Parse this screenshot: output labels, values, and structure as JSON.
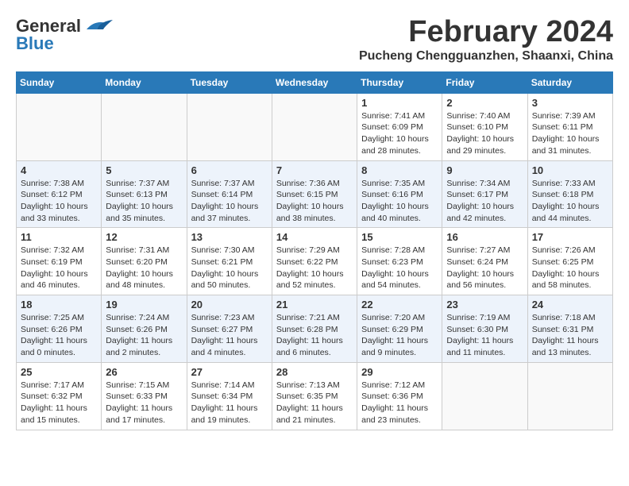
{
  "header": {
    "logo_line1": "General",
    "logo_line2": "Blue",
    "title": "February 2024",
    "subtitle": "Pucheng Chengguanzhen, Shaanxi, China"
  },
  "calendar": {
    "days_of_week": [
      "Sunday",
      "Monday",
      "Tuesday",
      "Wednesday",
      "Thursday",
      "Friday",
      "Saturday"
    ],
    "weeks": [
      [
        {
          "day": "",
          "info": ""
        },
        {
          "day": "",
          "info": ""
        },
        {
          "day": "",
          "info": ""
        },
        {
          "day": "",
          "info": ""
        },
        {
          "day": "1",
          "info": "Sunrise: 7:41 AM\nSunset: 6:09 PM\nDaylight: 10 hours\nand 28 minutes."
        },
        {
          "day": "2",
          "info": "Sunrise: 7:40 AM\nSunset: 6:10 PM\nDaylight: 10 hours\nand 29 minutes."
        },
        {
          "day": "3",
          "info": "Sunrise: 7:39 AM\nSunset: 6:11 PM\nDaylight: 10 hours\nand 31 minutes."
        }
      ],
      [
        {
          "day": "4",
          "info": "Sunrise: 7:38 AM\nSunset: 6:12 PM\nDaylight: 10 hours\nand 33 minutes."
        },
        {
          "day": "5",
          "info": "Sunrise: 7:37 AM\nSunset: 6:13 PM\nDaylight: 10 hours\nand 35 minutes."
        },
        {
          "day": "6",
          "info": "Sunrise: 7:37 AM\nSunset: 6:14 PM\nDaylight: 10 hours\nand 37 minutes."
        },
        {
          "day": "7",
          "info": "Sunrise: 7:36 AM\nSunset: 6:15 PM\nDaylight: 10 hours\nand 38 minutes."
        },
        {
          "day": "8",
          "info": "Sunrise: 7:35 AM\nSunset: 6:16 PM\nDaylight: 10 hours\nand 40 minutes."
        },
        {
          "day": "9",
          "info": "Sunrise: 7:34 AM\nSunset: 6:17 PM\nDaylight: 10 hours\nand 42 minutes."
        },
        {
          "day": "10",
          "info": "Sunrise: 7:33 AM\nSunset: 6:18 PM\nDaylight: 10 hours\nand 44 minutes."
        }
      ],
      [
        {
          "day": "11",
          "info": "Sunrise: 7:32 AM\nSunset: 6:19 PM\nDaylight: 10 hours\nand 46 minutes."
        },
        {
          "day": "12",
          "info": "Sunrise: 7:31 AM\nSunset: 6:20 PM\nDaylight: 10 hours\nand 48 minutes."
        },
        {
          "day": "13",
          "info": "Sunrise: 7:30 AM\nSunset: 6:21 PM\nDaylight: 10 hours\nand 50 minutes."
        },
        {
          "day": "14",
          "info": "Sunrise: 7:29 AM\nSunset: 6:22 PM\nDaylight: 10 hours\nand 52 minutes."
        },
        {
          "day": "15",
          "info": "Sunrise: 7:28 AM\nSunset: 6:23 PM\nDaylight: 10 hours\nand 54 minutes."
        },
        {
          "day": "16",
          "info": "Sunrise: 7:27 AM\nSunset: 6:24 PM\nDaylight: 10 hours\nand 56 minutes."
        },
        {
          "day": "17",
          "info": "Sunrise: 7:26 AM\nSunset: 6:25 PM\nDaylight: 10 hours\nand 58 minutes."
        }
      ],
      [
        {
          "day": "18",
          "info": "Sunrise: 7:25 AM\nSunset: 6:26 PM\nDaylight: 11 hours\nand 0 minutes."
        },
        {
          "day": "19",
          "info": "Sunrise: 7:24 AM\nSunset: 6:26 PM\nDaylight: 11 hours\nand 2 minutes."
        },
        {
          "day": "20",
          "info": "Sunrise: 7:23 AM\nSunset: 6:27 PM\nDaylight: 11 hours\nand 4 minutes."
        },
        {
          "day": "21",
          "info": "Sunrise: 7:21 AM\nSunset: 6:28 PM\nDaylight: 11 hours\nand 6 minutes."
        },
        {
          "day": "22",
          "info": "Sunrise: 7:20 AM\nSunset: 6:29 PM\nDaylight: 11 hours\nand 9 minutes."
        },
        {
          "day": "23",
          "info": "Sunrise: 7:19 AM\nSunset: 6:30 PM\nDaylight: 11 hours\nand 11 minutes."
        },
        {
          "day": "24",
          "info": "Sunrise: 7:18 AM\nSunset: 6:31 PM\nDaylight: 11 hours\nand 13 minutes."
        }
      ],
      [
        {
          "day": "25",
          "info": "Sunrise: 7:17 AM\nSunset: 6:32 PM\nDaylight: 11 hours\nand 15 minutes."
        },
        {
          "day": "26",
          "info": "Sunrise: 7:15 AM\nSunset: 6:33 PM\nDaylight: 11 hours\nand 17 minutes."
        },
        {
          "day": "27",
          "info": "Sunrise: 7:14 AM\nSunset: 6:34 PM\nDaylight: 11 hours\nand 19 minutes."
        },
        {
          "day": "28",
          "info": "Sunrise: 7:13 AM\nSunset: 6:35 PM\nDaylight: 11 hours\nand 21 minutes."
        },
        {
          "day": "29",
          "info": "Sunrise: 7:12 AM\nSunset: 6:36 PM\nDaylight: 11 hours\nand 23 minutes."
        },
        {
          "day": "",
          "info": ""
        },
        {
          "day": "",
          "info": ""
        }
      ]
    ]
  }
}
